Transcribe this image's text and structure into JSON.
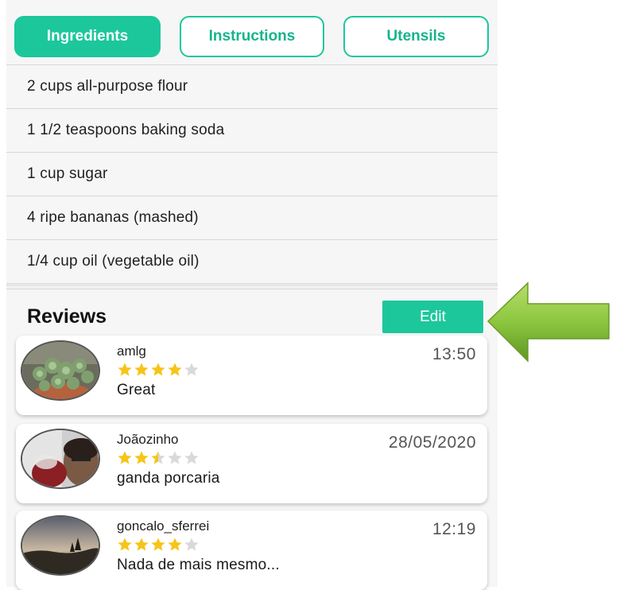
{
  "tabs": [
    {
      "label": "Ingredients",
      "active": true
    },
    {
      "label": "Instructions",
      "active": false
    },
    {
      "label": "Utensils",
      "active": false
    }
  ],
  "ingredients": [
    "2 cups all-purpose flour",
    "1 1/2 teaspoons baking soda",
    "1 cup sugar",
    "4 ripe bananas (mashed)",
    "1/4 cup oil (vegetable oil)"
  ],
  "reviews": {
    "title": "Reviews",
    "edit_label": "Edit",
    "items": [
      {
        "user": "amlg",
        "time": "13:50",
        "rating": 4,
        "text": "Great",
        "avatar": "succulent-plant-photo"
      },
      {
        "user": "Joãozinho",
        "time": "28/05/2020",
        "rating": 2.5,
        "text": "ganda porcaria",
        "avatar": "person-selfie-photo"
      },
      {
        "user": "goncalo_sferrei",
        "time": "12:19",
        "rating": 4,
        "text": "Nada de mais mesmo...",
        "avatar": "sunset-landscape-photo"
      }
    ]
  },
  "colors": {
    "accent": "#1cc79c",
    "star": "#f5c518",
    "star_empty": "#d9d9d9",
    "arrow": "#8cc63f"
  }
}
